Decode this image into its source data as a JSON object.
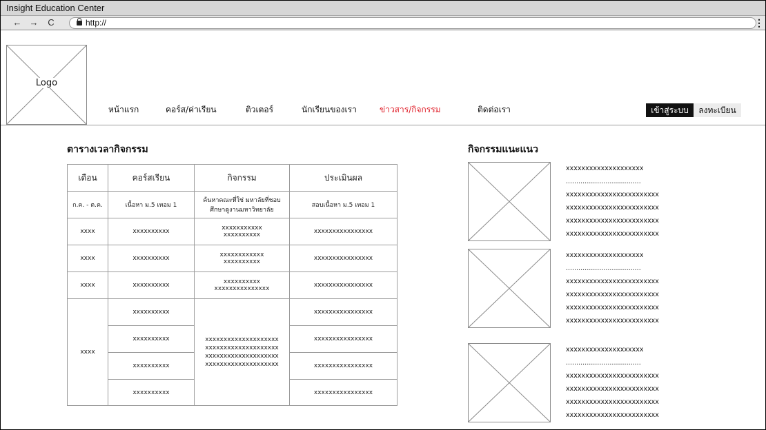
{
  "window": {
    "title": "Insight Education Center",
    "url": "http://"
  },
  "browser": {
    "back": "←",
    "forward": "→",
    "reload": "C",
    "menu": "⋮"
  },
  "header": {
    "logo_label": "Logo",
    "nav": [
      {
        "label": "หน้าแรก"
      },
      {
        "label": "คอร์ส/ค่าเรียน"
      },
      {
        "label": "ติวเตอร์"
      },
      {
        "label": "นักเรียนของเรา"
      },
      {
        "label": "ข่าวสาร/กิจกรรม",
        "active": true
      },
      {
        "label": "ติดต่อเรา"
      }
    ],
    "login": "เข้าสู่ระบบ",
    "register": "ลงทะเบียน"
  },
  "colors": {
    "active_nav": "#e0202a",
    "login_bg": "#111111"
  },
  "schedule": {
    "title": "ตารางเวลากิจกรรม",
    "headers": [
      "เดือน",
      "คอร์สเรียน",
      "กิจกรรม",
      "ประเมินผล"
    ],
    "row1": {
      "month": "ก.ค. - ต.ค.",
      "course": "เนื้อหา ม.5 เทอม 1",
      "activity_1": "ค้นหาคณะที่ใช่ มหาลัยที่ชอบ",
      "activity_2": "ศึกษาดูงานมหาวิทยาลัย",
      "evaluation": "สอบเนื้อหา ม.5 เทอม 1"
    },
    "row2": {
      "month": "xxxx",
      "course": "xxxxxxxxxx",
      "activity_1": "xxxxxxxxxxx",
      "activity_2": "xxxxxxxxxx",
      "evaluation": "xxxxxxxxxxxxxxxx"
    },
    "row3": {
      "month": "xxxx",
      "course": "xxxxxxxxxx",
      "activity_1": "xxxxxxxxxxxx",
      "activity_2": "xxxxxxxxxx",
      "evaluation": "xxxxxxxxxxxxxxxx"
    },
    "row4": {
      "month": "xxxx",
      "course": "xxxxxxxxxx",
      "activity_1": "xxxxxxxxxx",
      "activity_2": "xxxxxxxxxxxxxxx",
      "evaluation": "xxxxxxxxxxxxxxxx"
    },
    "group": {
      "month": "xxxx",
      "courses": [
        "xxxxxxxxxx",
        "xxxxxxxxxx",
        "xxxxxxxxxx",
        "xxxxxxxxxx"
      ],
      "activity_lines": [
        "xxxxxxxxxxxxxxxxxxxx",
        "xxxxxxxxxxxxxxxxxxxx",
        "xxxxxxxxxxxxxxxxxxxx",
        "xxxxxxxxxxxxxxxxxxxx"
      ],
      "evaluations": [
        "xxxxxxxxxxxxxxxx",
        "xxxxxxxxxxxxxxxx",
        "xxxxxxxxxxxxxxxx",
        "xxxxxxxxxxxxxxxx"
      ]
    }
  },
  "recommended": {
    "title": "กิจกรรมแนะแนว",
    "cards": [
      {
        "lines": [
          "xxxxxxxxxxxxxxxxxxxx",
          "....................................",
          "xxxxxxxxxxxxxxxxxxxxxxxx",
          "xxxxxxxxxxxxxxxxxxxxxxxx",
          "xxxxxxxxxxxxxxxxxxxxxxxx",
          "xxxxxxxxxxxxxxxxxxxxxxxx"
        ]
      },
      {
        "lines": [
          "xxxxxxxxxxxxxxxxxxxx",
          "....................................",
          "xxxxxxxxxxxxxxxxxxxxxxxx",
          "xxxxxxxxxxxxxxxxxxxxxxxx",
          "xxxxxxxxxxxxxxxxxxxxxxxx",
          "xxxxxxxxxxxxxxxxxxxxxxxx"
        ]
      },
      {
        "lines": [
          "xxxxxxxxxxxxxxxxxxxx",
          "....................................",
          "xxxxxxxxxxxxxxxxxxxxxxxx",
          "xxxxxxxxxxxxxxxxxxxxxxxx",
          "xxxxxxxxxxxxxxxxxxxxxxxx",
          "xxxxxxxxxxxxxxxxxxxxxxxx"
        ]
      }
    ]
  }
}
